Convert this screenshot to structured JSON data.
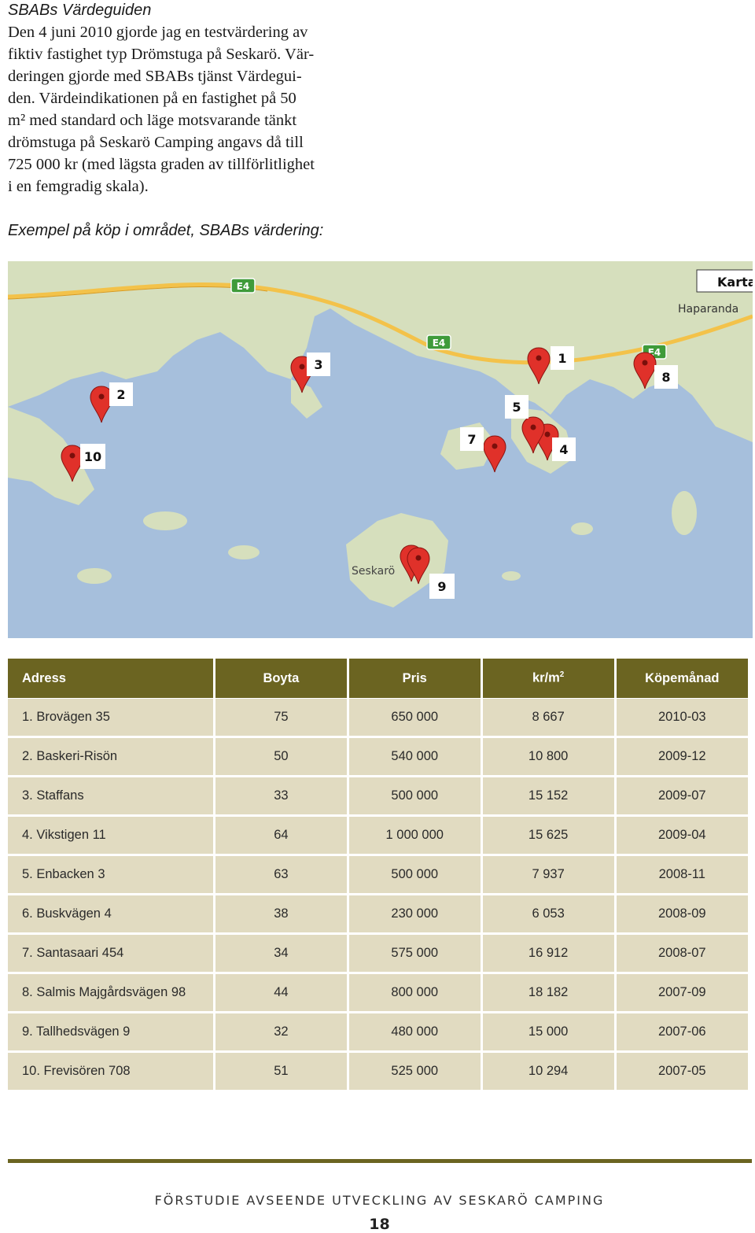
{
  "section": {
    "heading": "SBABs Värdeguiden",
    "body_lines": [
      "Den 4 juni 2010 gjorde jag en testvärdering av",
      "fiktiv fastighet typ Drömstuga på Seskarö. Vär-",
      "deringen gjorde med SBABs tjänst Värdegui-",
      "den. Värdeindikationen på en fastighet på 50",
      "m² med standard och läge motsvarande tänkt",
      "drömstuga på Seskarö Camping angavs då till",
      "725 000 kr (med lägsta graden av tillförlitlighet",
      "i en femgradig skala)."
    ],
    "caption": "Exempel på köp i området, SBABs värdering:"
  },
  "map": {
    "place_labels": {
      "karta": "Karta",
      "haparanda": "Haparanda",
      "seskaro": "Seskarö"
    },
    "road_labels": [
      "E4",
      "E4",
      "E4"
    ],
    "markers": [
      {
        "label": "1"
      },
      {
        "label": "2"
      },
      {
        "label": "3"
      },
      {
        "label": "4"
      },
      {
        "label": "5"
      },
      {
        "label": "7"
      },
      {
        "label": "8"
      },
      {
        "label": "9"
      },
      {
        "label": "10"
      }
    ],
    "colors": {
      "water": "#a6bfdc",
      "land": "#d6dfbd",
      "road": "#f3c24a",
      "marker": "#e0312a",
      "road_sign": "#3f9b3a"
    }
  },
  "table": {
    "headers": [
      "Adress",
      "Boyta",
      "Pris",
      "kr/m",
      "Köpemånad"
    ],
    "header_superscript": "2",
    "rows": [
      [
        "1. Brovägen 35",
        "75",
        "650 000",
        "8 667",
        "2010-03"
      ],
      [
        "2. Baskeri-Risön",
        "50",
        "540 000",
        "10 800",
        "2009-12"
      ],
      [
        "3. Staffans",
        "33",
        "500 000",
        "15 152",
        "2009-07"
      ],
      [
        "4. Vikstigen 11",
        "64",
        "1 000 000",
        "15 625",
        "2009-04"
      ],
      [
        "5. Enbacken 3",
        "63",
        "500 000",
        "7 937",
        "2008-11"
      ],
      [
        "6. Buskvägen 4",
        "38",
        "230 000",
        "6 053",
        "2008-09"
      ],
      [
        "7. Santasaari 454",
        "34",
        "575 000",
        "16 912",
        "2008-07"
      ],
      [
        "8. Salmis Majgårdsvägen 98",
        "44",
        "800 000",
        "18 182",
        "2007-09"
      ],
      [
        "9. Tallhedsvägen 9",
        "32",
        "480 000",
        "15 000",
        "2007-06"
      ],
      [
        "10. Frevisören 708",
        "51",
        "525 000",
        "10 294",
        "2007-05"
      ]
    ],
    "colors": {
      "header_bg": "#6b6421",
      "row_bg": "#e1dbc1"
    }
  },
  "footer": {
    "title": "FÖRSTUDIE AVSEENDE UTVECKLING AV SESKARÖ CAMPING",
    "page_number": "18"
  }
}
